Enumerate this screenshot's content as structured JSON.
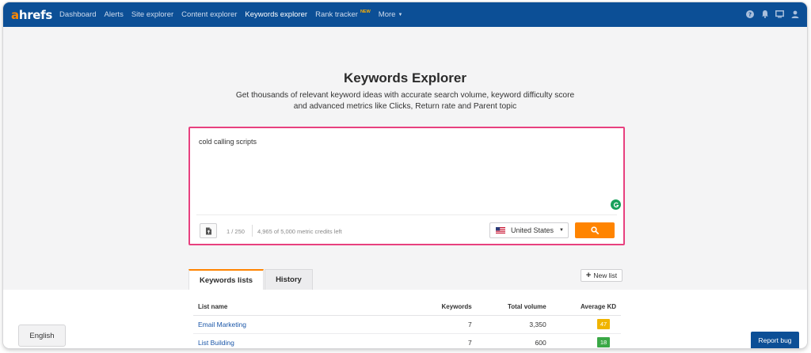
{
  "nav": {
    "logo_a": "a",
    "logo_rest": "hrefs",
    "items": [
      {
        "label": "Dashboard"
      },
      {
        "label": "Alerts"
      },
      {
        "label": "Site explorer"
      },
      {
        "label": "Content explorer"
      },
      {
        "label": "Keywords explorer",
        "active": true
      },
      {
        "label": "Rank tracker",
        "badge": "NEW"
      },
      {
        "label": "More"
      }
    ],
    "icons": [
      "help-icon",
      "bell-icon",
      "monitor-icon",
      "user-icon"
    ]
  },
  "hero": {
    "title": "Keywords Explorer",
    "subtitle_line1": "Get thousands of relevant keyword ideas with accurate search volume, keyword difficulty score",
    "subtitle_line2": "and advanced metrics like Clicks, Return rate and Parent topic"
  },
  "search": {
    "value": "cold calling scripts",
    "counter": "1 / 250",
    "credits": "4,965 of 5,000 metric credits left",
    "country": "United States"
  },
  "tabs": [
    {
      "label": "Keywords lists",
      "active": true
    },
    {
      "label": "History",
      "active": false
    }
  ],
  "new_list_label": "New list",
  "table": {
    "headers": [
      "List name",
      "Keywords",
      "Total volume",
      "Average KD"
    ],
    "rows": [
      {
        "name": "Email Marketing",
        "keywords": "7",
        "volume": "3,350",
        "kd": "47",
        "kd_color": "#f0b400"
      },
      {
        "name": "List Building",
        "keywords": "7",
        "volume": "600",
        "kd": "18",
        "kd_color": "#3aa846"
      }
    ]
  },
  "footer": {
    "language": "English",
    "report_bug": "Report bug"
  },
  "colors": {
    "nav_bg": "#0c4f96",
    "accent_orange": "#ff8400",
    "search_border": "#e8407f",
    "link": "#1a56a8"
  }
}
